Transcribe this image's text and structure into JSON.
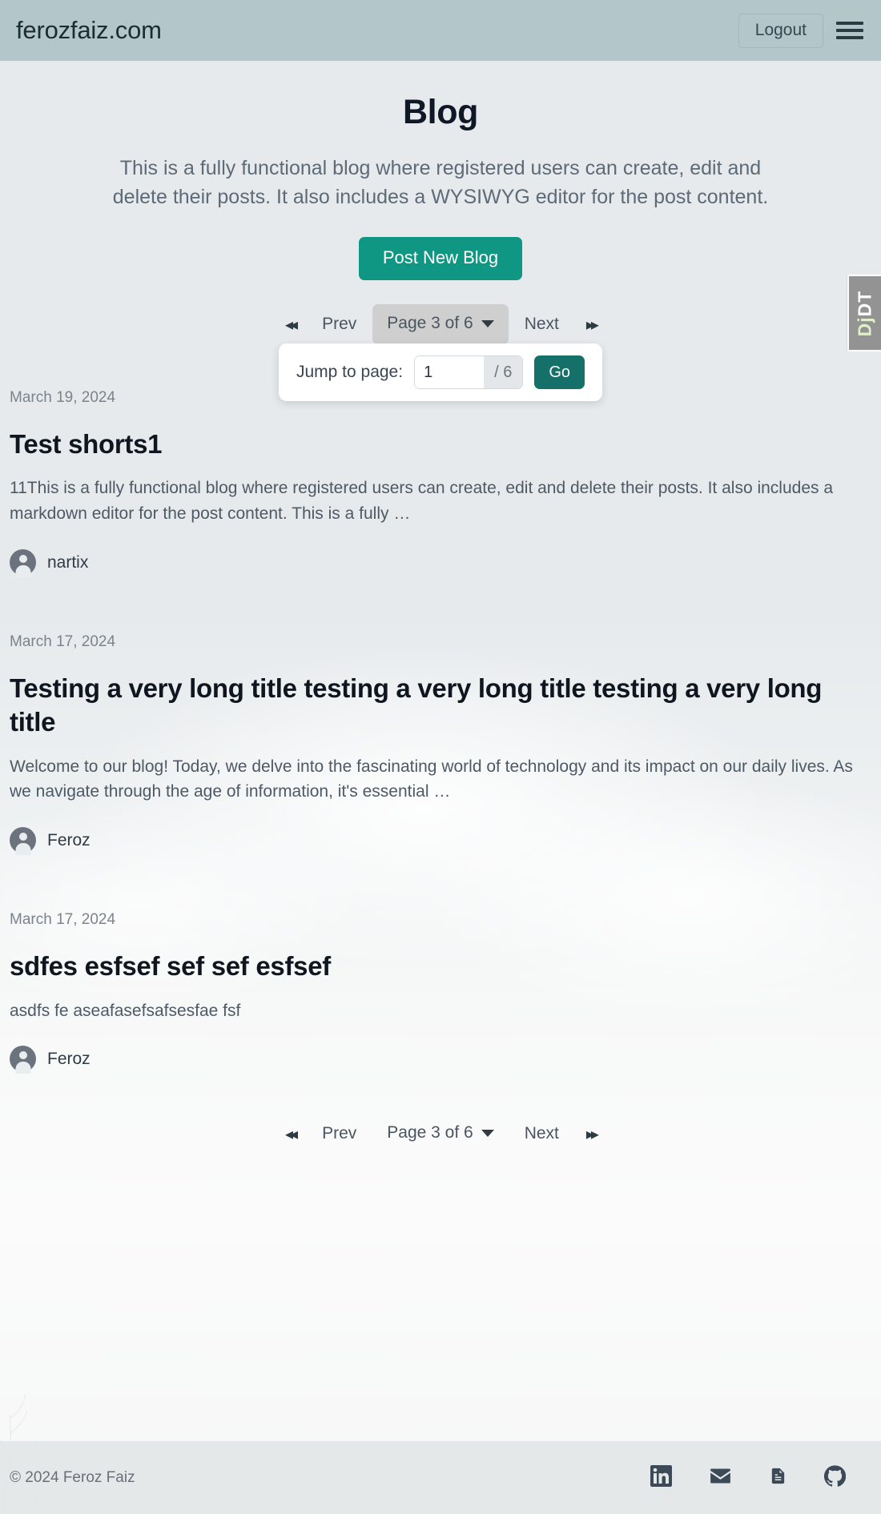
{
  "header": {
    "brand": "ferozfaiz.com",
    "logout_label": "Logout",
    "menu_icon": "hamburger-menu-icon"
  },
  "hero": {
    "title": "Blog",
    "description": "This is a fully functional blog where registered users can create, edit and delete their posts. It also includes a WYSIWYG editor for the post content.",
    "post_new_label": "Post New Blog"
  },
  "pagination_top": {
    "first_arrow": "◂◂",
    "prev_label": "Prev",
    "page_label": "Page 3 of 6",
    "next_label": "Next",
    "last_arrow": "▸▸",
    "current_page": 3,
    "total_pages": 6,
    "expanded": true
  },
  "jump_panel": {
    "label": "Jump to page:",
    "value": "1",
    "placeholder": "1",
    "total": "/ 6",
    "go_label": "Go"
  },
  "pagination_bottom": {
    "first_arrow": "◂◂",
    "prev_label": "Prev",
    "page_label": "Page 3 of 6",
    "next_label": "Next",
    "last_arrow": "▸▸"
  },
  "posts": [
    {
      "date": "March 19, 2024",
      "title": "Test shorts1",
      "excerpt": "11This is a fully functional blog where registered users can create, edit and delete their posts. It also includes a markdown editor for the post content. This is a fully …",
      "author": "nartix"
    },
    {
      "date": "March 17, 2024",
      "title": "Testing a very long title testing a very long title testing a very long title",
      "excerpt": "Welcome to our blog! Today, we delve into the fascinating world of technology and its impact on our daily lives. As we navigate through the age of information, it's essential …",
      "author": "Feroz"
    },
    {
      "date": "March 17, 2024",
      "title": "sdfes esfsef sef sef esfsef",
      "excerpt": "asdfs fe aseafasefsafsesfae fsf",
      "author": "Feroz"
    }
  ],
  "footer": {
    "copyright": "© 2024 Feroz Faiz",
    "social": [
      {
        "name": "linkedin-icon"
      },
      {
        "name": "email-icon"
      },
      {
        "name": "resume-document-icon"
      },
      {
        "name": "github-icon"
      }
    ]
  },
  "debug_toolbar": {
    "prefix": "Dj",
    "suffix": "DT"
  },
  "colors": {
    "header_bg": "#b3c6c9",
    "accent_button": "#0f9784",
    "go_button": "#147068",
    "page_bg": "#e6eaec",
    "text_dark": "#101726",
    "text_muted": "#5d6a77"
  }
}
